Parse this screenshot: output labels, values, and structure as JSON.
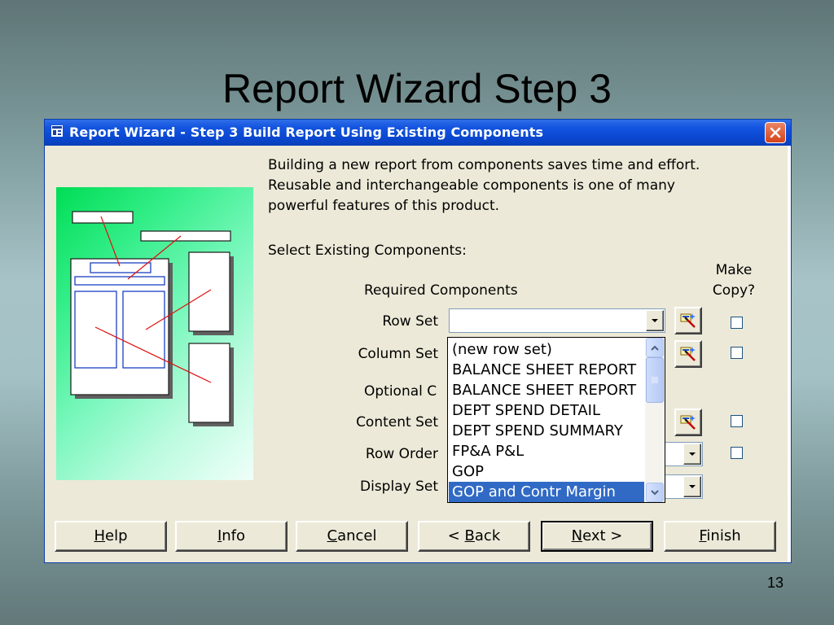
{
  "slide": {
    "title": "Report Wizard Step 3",
    "page_number": "13"
  },
  "dialog": {
    "title": "Report Wizard - Step 3 Build Report Using Existing Components",
    "description": [
      "Building a new report from components saves time and effort.",
      "Reusable and interchangeable components is one of many",
      "powerful features of this product."
    ],
    "select_label": "Select Existing Components:",
    "make_copy_label": [
      "Make",
      "Copy?"
    ],
    "required_label": "Required Components",
    "optional_label": "Optional C",
    "rows": {
      "row_set": {
        "label": "Row Set",
        "value": ""
      },
      "column_set": {
        "label": "Column Set"
      },
      "content_set": {
        "label": "Content Set"
      },
      "row_order": {
        "label": "Row Order"
      },
      "display_set": {
        "label": "Display Set"
      }
    },
    "dropdown": {
      "items": [
        "(new row set)",
        "BALANCE SHEET REPORT",
        "BALANCE SHEET REPORT",
        "DEPT SPEND DETAIL",
        "DEPT SPEND SUMMARY",
        "FP&A P&L",
        "GOP",
        "GOP and Contr Margin"
      ],
      "selected_index": 7
    },
    "buttons": {
      "help": {
        "mnemonic": "H",
        "rest": "elp"
      },
      "info": {
        "mnemonic": "I",
        "rest": "nfo"
      },
      "cancel": {
        "mnemonic": "C",
        "rest": "ancel"
      },
      "back": {
        "prefix": "< ",
        "mnemonic": "B",
        "rest": "ack"
      },
      "next": {
        "mnemonic": "N",
        "rest": "ext",
        "suffix": " >"
      },
      "finish": {
        "mnemonic": "F",
        "rest": "inish"
      }
    },
    "icons": {
      "app": "wizard-app-icon",
      "close": "close-icon",
      "wand": "magic-wand-icon",
      "dropdown_arrow": "chevron-down-icon"
    },
    "colors": {
      "titlebar": "#0a47d0",
      "selection": "#316ac5",
      "close": "#d4431a",
      "illustration_green": "#00dd55"
    }
  }
}
